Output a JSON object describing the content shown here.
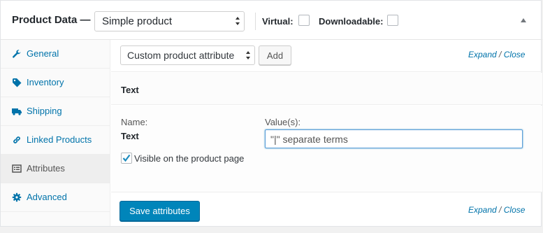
{
  "header": {
    "title": "Product Data —",
    "product_type": "Simple product",
    "virtual_label": "Virtual:",
    "downloadable_label": "Downloadable:",
    "virtual_checked": false,
    "downloadable_checked": false
  },
  "sidebar": {
    "items": [
      {
        "label": "General",
        "icon": "wrench-icon",
        "active": false
      },
      {
        "label": "Inventory",
        "icon": "tag-icon",
        "active": false
      },
      {
        "label": "Shipping",
        "icon": "truck-icon",
        "active": false
      },
      {
        "label": "Linked Products",
        "icon": "link-icon",
        "active": false
      },
      {
        "label": "Attributes",
        "icon": "list-icon",
        "active": true
      },
      {
        "label": "Advanced",
        "icon": "gear-icon",
        "active": false
      }
    ]
  },
  "toolbar": {
    "attribute_select": "Custom product attribute",
    "add_label": "Add",
    "expand_label": "Expand",
    "slash": "/",
    "close_label": "Close"
  },
  "attribute": {
    "title": "Text",
    "name_label": "Name:",
    "name_value": "Text",
    "values_label": "Value(s):",
    "values_placeholder": "\"|\" separate terms",
    "visible_label": "Visible on the product page",
    "visible_checked": true
  },
  "footer": {
    "save_label": "Save attributes",
    "expand_label": "Expand",
    "slash": "/",
    "close_label": "Close"
  },
  "colors": {
    "link": "#0073aa",
    "primary_button": "#0085ba",
    "active_tab_bg": "#eeeeee"
  }
}
